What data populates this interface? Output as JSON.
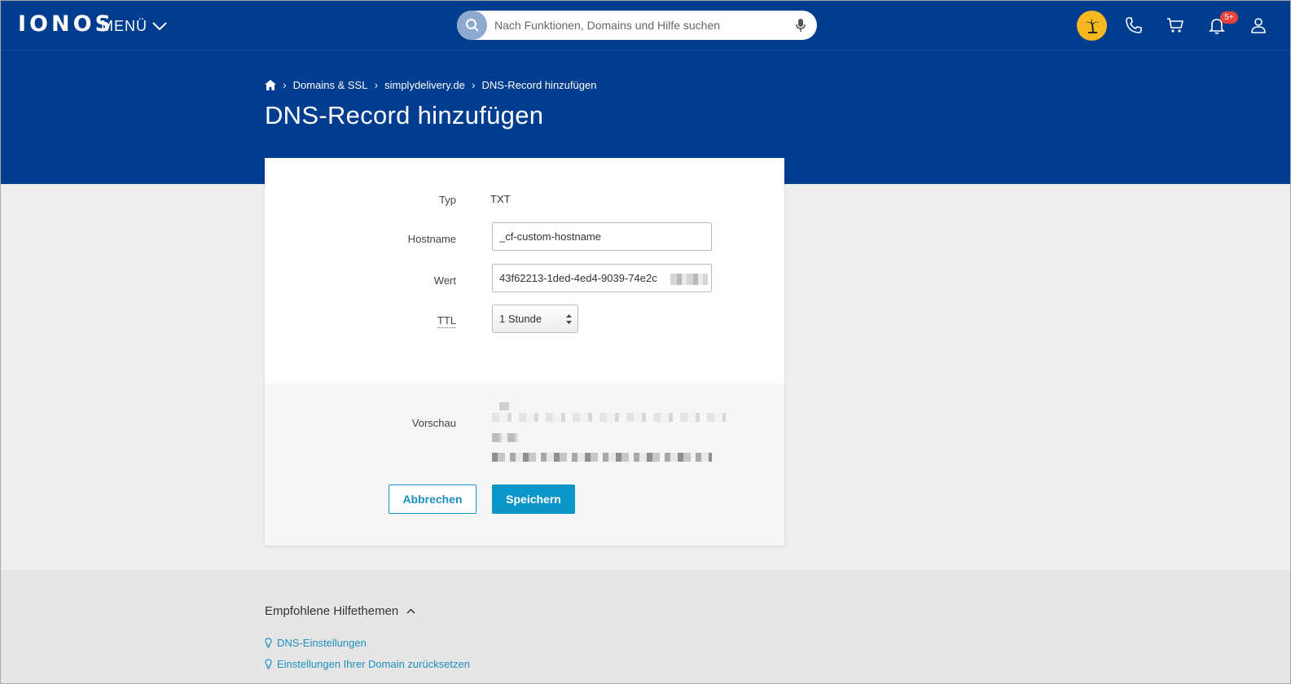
{
  "header": {
    "logo": "IONOS",
    "menu_label": "MENÜ",
    "search_placeholder": "Nach Funktionen, Domains und Hilfe suchen",
    "notification_badge": "5+",
    "colors": {
      "header_bg": "#003d8f",
      "palm_bg": "#f6b820",
      "badge_bg": "#e8423f"
    },
    "icons": [
      "search-icon",
      "microphone-icon",
      "palm-tree-icon",
      "phone-icon",
      "cart-icon",
      "bell-icon",
      "user-icon"
    ]
  },
  "breadcrumb": {
    "home_icon": "home-icon",
    "items": [
      "Domains & SSL",
      "simplydelivery.de",
      "DNS-Record hinzufügen"
    ]
  },
  "page": {
    "title": "DNS-Record hinzufügen"
  },
  "form": {
    "type_label": "Typ",
    "type_value": "TXT",
    "hostname_label": "Hostname",
    "hostname_value": "_cf-custom-hostname",
    "value_label": "Wert",
    "value_value": "43f62213-1ded-4ed4-9039-74e2c",
    "ttl_label": "TTL",
    "ttl_value": "1 Stunde",
    "preview_label": "Vorschau",
    "cancel_label": "Abbrechen",
    "save_label": "Speichern",
    "colors": {
      "primary": "#0c95c8"
    }
  },
  "help": {
    "title": "Empfohlene Hilfethemen",
    "links": [
      "DNS-Einstellungen",
      "Einstellungen Ihrer Domain zurücksetzen"
    ]
  }
}
